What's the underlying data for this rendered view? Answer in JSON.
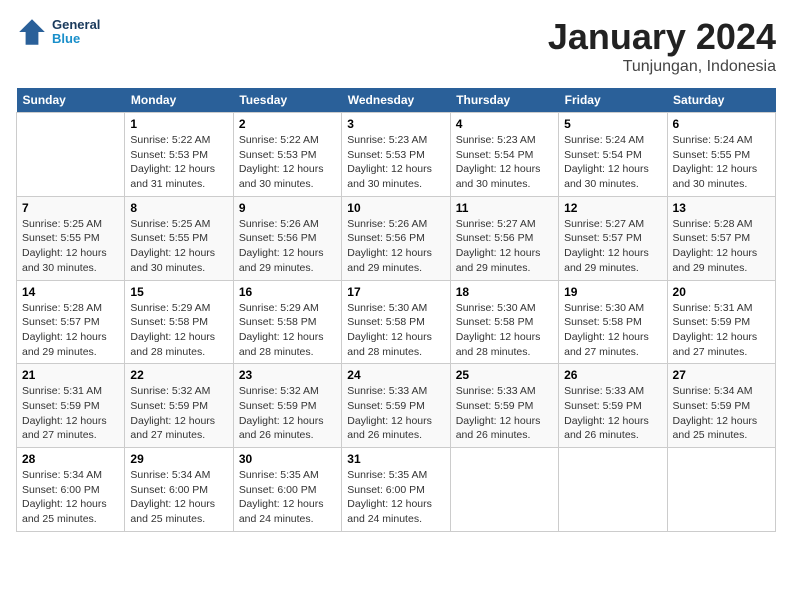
{
  "header": {
    "logo_line1": "General",
    "logo_line2": "Blue",
    "month": "January 2024",
    "location": "Tunjungan, Indonesia"
  },
  "days_of_week": [
    "Sunday",
    "Monday",
    "Tuesday",
    "Wednesday",
    "Thursday",
    "Friday",
    "Saturday"
  ],
  "weeks": [
    [
      {
        "num": "",
        "info": ""
      },
      {
        "num": "1",
        "info": "Sunrise: 5:22 AM\nSunset: 5:53 PM\nDaylight: 12 hours\nand 31 minutes."
      },
      {
        "num": "2",
        "info": "Sunrise: 5:22 AM\nSunset: 5:53 PM\nDaylight: 12 hours\nand 30 minutes."
      },
      {
        "num": "3",
        "info": "Sunrise: 5:23 AM\nSunset: 5:53 PM\nDaylight: 12 hours\nand 30 minutes."
      },
      {
        "num": "4",
        "info": "Sunrise: 5:23 AM\nSunset: 5:54 PM\nDaylight: 12 hours\nand 30 minutes."
      },
      {
        "num": "5",
        "info": "Sunrise: 5:24 AM\nSunset: 5:54 PM\nDaylight: 12 hours\nand 30 minutes."
      },
      {
        "num": "6",
        "info": "Sunrise: 5:24 AM\nSunset: 5:55 PM\nDaylight: 12 hours\nand 30 minutes."
      }
    ],
    [
      {
        "num": "7",
        "info": "Sunrise: 5:25 AM\nSunset: 5:55 PM\nDaylight: 12 hours\nand 30 minutes."
      },
      {
        "num": "8",
        "info": "Sunrise: 5:25 AM\nSunset: 5:55 PM\nDaylight: 12 hours\nand 30 minutes."
      },
      {
        "num": "9",
        "info": "Sunrise: 5:26 AM\nSunset: 5:56 PM\nDaylight: 12 hours\nand 29 minutes."
      },
      {
        "num": "10",
        "info": "Sunrise: 5:26 AM\nSunset: 5:56 PM\nDaylight: 12 hours\nand 29 minutes."
      },
      {
        "num": "11",
        "info": "Sunrise: 5:27 AM\nSunset: 5:56 PM\nDaylight: 12 hours\nand 29 minutes."
      },
      {
        "num": "12",
        "info": "Sunrise: 5:27 AM\nSunset: 5:57 PM\nDaylight: 12 hours\nand 29 minutes."
      },
      {
        "num": "13",
        "info": "Sunrise: 5:28 AM\nSunset: 5:57 PM\nDaylight: 12 hours\nand 29 minutes."
      }
    ],
    [
      {
        "num": "14",
        "info": "Sunrise: 5:28 AM\nSunset: 5:57 PM\nDaylight: 12 hours\nand 29 minutes."
      },
      {
        "num": "15",
        "info": "Sunrise: 5:29 AM\nSunset: 5:58 PM\nDaylight: 12 hours\nand 28 minutes."
      },
      {
        "num": "16",
        "info": "Sunrise: 5:29 AM\nSunset: 5:58 PM\nDaylight: 12 hours\nand 28 minutes."
      },
      {
        "num": "17",
        "info": "Sunrise: 5:30 AM\nSunset: 5:58 PM\nDaylight: 12 hours\nand 28 minutes."
      },
      {
        "num": "18",
        "info": "Sunrise: 5:30 AM\nSunset: 5:58 PM\nDaylight: 12 hours\nand 28 minutes."
      },
      {
        "num": "19",
        "info": "Sunrise: 5:30 AM\nSunset: 5:58 PM\nDaylight: 12 hours\nand 27 minutes."
      },
      {
        "num": "20",
        "info": "Sunrise: 5:31 AM\nSunset: 5:59 PM\nDaylight: 12 hours\nand 27 minutes."
      }
    ],
    [
      {
        "num": "21",
        "info": "Sunrise: 5:31 AM\nSunset: 5:59 PM\nDaylight: 12 hours\nand 27 minutes."
      },
      {
        "num": "22",
        "info": "Sunrise: 5:32 AM\nSunset: 5:59 PM\nDaylight: 12 hours\nand 27 minutes."
      },
      {
        "num": "23",
        "info": "Sunrise: 5:32 AM\nSunset: 5:59 PM\nDaylight: 12 hours\nand 26 minutes."
      },
      {
        "num": "24",
        "info": "Sunrise: 5:33 AM\nSunset: 5:59 PM\nDaylight: 12 hours\nand 26 minutes."
      },
      {
        "num": "25",
        "info": "Sunrise: 5:33 AM\nSunset: 5:59 PM\nDaylight: 12 hours\nand 26 minutes."
      },
      {
        "num": "26",
        "info": "Sunrise: 5:33 AM\nSunset: 5:59 PM\nDaylight: 12 hours\nand 26 minutes."
      },
      {
        "num": "27",
        "info": "Sunrise: 5:34 AM\nSunset: 5:59 PM\nDaylight: 12 hours\nand 25 minutes."
      }
    ],
    [
      {
        "num": "28",
        "info": "Sunrise: 5:34 AM\nSunset: 6:00 PM\nDaylight: 12 hours\nand 25 minutes."
      },
      {
        "num": "29",
        "info": "Sunrise: 5:34 AM\nSunset: 6:00 PM\nDaylight: 12 hours\nand 25 minutes."
      },
      {
        "num": "30",
        "info": "Sunrise: 5:35 AM\nSunset: 6:00 PM\nDaylight: 12 hours\nand 24 minutes."
      },
      {
        "num": "31",
        "info": "Sunrise: 5:35 AM\nSunset: 6:00 PM\nDaylight: 12 hours\nand 24 minutes."
      },
      {
        "num": "",
        "info": ""
      },
      {
        "num": "",
        "info": ""
      },
      {
        "num": "",
        "info": ""
      }
    ]
  ]
}
